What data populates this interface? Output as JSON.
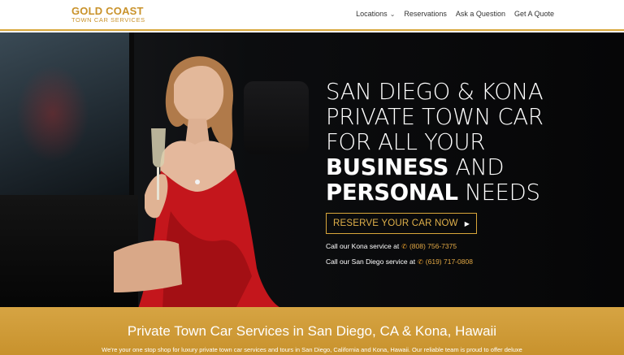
{
  "header": {
    "logo_main": "GOLD COAST",
    "logo_sub": "TOWN CAR SERVICES",
    "nav": [
      {
        "label": "Locations",
        "has_dropdown": true
      },
      {
        "label": "Reservations"
      },
      {
        "label": "Ask a Question"
      },
      {
        "label": "Get A Quote"
      }
    ]
  },
  "hero": {
    "headline_line1": "SAN DIEGO & KONA",
    "headline_line2": "PRIVATE TOWN CAR",
    "headline_line3": "FOR ALL YOUR",
    "headline_bold1": "BUSINESS",
    "headline_and": " AND",
    "headline_bold2": "PERSONAL",
    "headline_needs": " NEEDS",
    "cta_label": "RESERVE YOUR CAR NOW",
    "call_kona_prefix": "Call our Kona service at",
    "call_kona_phone": "(808) 756-7375",
    "call_sd_prefix": "Call our San Diego service at",
    "call_sd_phone": "(619) 717-0808"
  },
  "band": {
    "title": "Private Town Car Services in San Diego, CA & Kona, Hawaii",
    "text": "We're your one stop shop for luxury private town car services and tours in San Diego, California and Kona, Hawaii. Our reliable team is proud to offer deluxe"
  },
  "colors": {
    "brand_gold": "#c9922a",
    "band_gold": "#d6a443",
    "hero_bg": "#0c0d0f"
  },
  "icons": {
    "dropdown": "chevron-down-icon",
    "cta_arrow": "play-arrow-icon",
    "phone": "phone-icon"
  }
}
